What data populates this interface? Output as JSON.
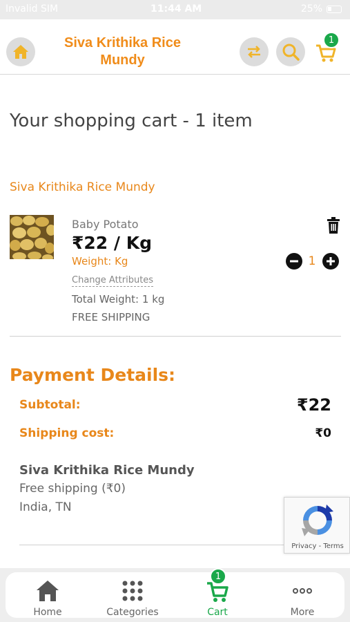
{
  "status_bar": {
    "carrier": "Invalid SIM",
    "time": "11:44 AM",
    "battery": "25%"
  },
  "header": {
    "store_title": "Siva Krithika Rice Mundy",
    "cart_count": "1"
  },
  "cart": {
    "heading": "Your shopping cart - 1 item",
    "store_name": "Siva Krithika Rice Mundy",
    "item": {
      "name": "Baby Potato",
      "price": "₹22 / Kg",
      "weight": "Weight: Kg",
      "change_attributes": "Change Attributes",
      "total_weight": "Total Weight: 1 kg",
      "shipping": "FREE SHIPPING",
      "quantity": "1"
    }
  },
  "payment": {
    "title": "Payment Details:",
    "subtotal_label": "Subtotal:",
    "subtotal_value": "₹22",
    "shipping_label": "Shipping cost:",
    "shipping_value": "₹0",
    "shipping_store": "Siva Krithika Rice Mundy",
    "shipping_desc": "Free shipping (₹0)",
    "shipping_location": "India, TN"
  },
  "recaptcha": {
    "terms": "Privacy - Terms"
  },
  "bottom_nav": {
    "items": [
      {
        "label": "Home",
        "icon": "home-icon"
      },
      {
        "label": "Categories",
        "icon": "grid-icon"
      },
      {
        "label": "Cart",
        "icon": "cart-icon",
        "badge": "1"
      },
      {
        "label": "More",
        "icon": "more-icon"
      }
    ]
  },
  "colors": {
    "accent_orange": "#e8871a",
    "active_green": "#1aa84a",
    "icon_gold": "#f0b429"
  }
}
